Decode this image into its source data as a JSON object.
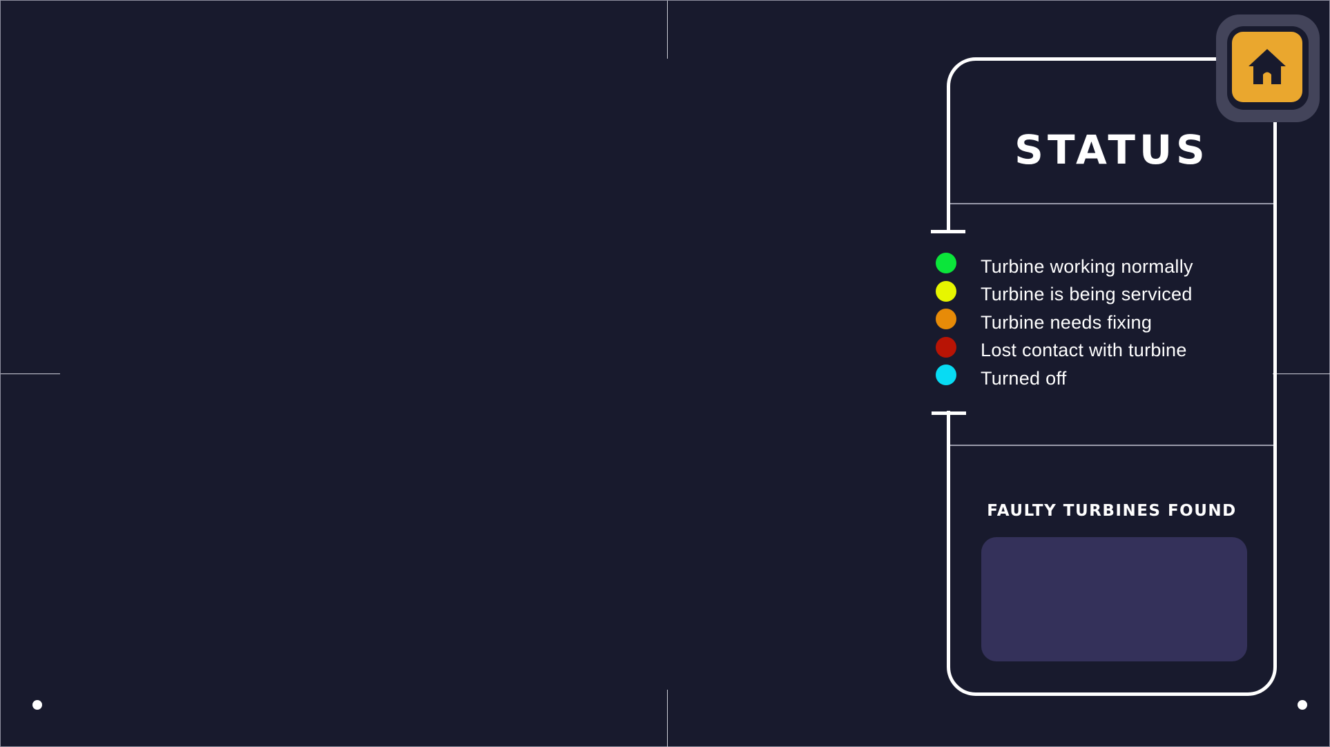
{
  "status_panel": {
    "title": "STATUS",
    "legend": [
      {
        "label": "Turbine working normally",
        "color": "#0be53a"
      },
      {
        "label": "Turbine is being serviced",
        "color": "#e7f600"
      },
      {
        "label": "Turbine needs fixing",
        "color": "#e78b08"
      },
      {
        "label": "Lost contact with turbine",
        "color": "#b81405"
      },
      {
        "label": "Turned off",
        "color": "#08dbf3"
      }
    ],
    "faulty_title": "FAULTY TURBINES FOUND",
    "faulty_value": ""
  },
  "home_button": {
    "icon": "home-icon",
    "color": "#eaa72e"
  },
  "colors": {
    "background": "#181a2d",
    "panel_border": "#ffffff",
    "faulty_box": "#34315a"
  }
}
